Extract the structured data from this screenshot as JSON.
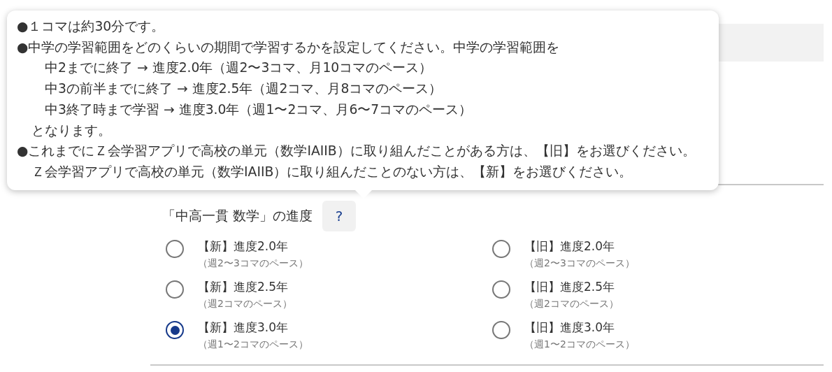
{
  "tooltip": {
    "lines": [
      {
        "kind": "bullet",
        "text": "●１コマは約30分です。"
      },
      {
        "kind": "bullet",
        "text": "●中学の学習範囲をどのくらいの期間で学習するかを設定してください。中学の学習範囲を"
      },
      {
        "kind": "indent",
        "text": "中2までに終了 → 進度2.0年（週2〜3コマ、月10コマのペース）"
      },
      {
        "kind": "indent",
        "text": "中3の前半までに終了 → 進度2.5年（週2コマ、月8コマのペース）"
      },
      {
        "kind": "indent",
        "text": "中3終了時まで学習 → 進度3.0年（週1〜2コマ、月6〜7コマのペース）"
      },
      {
        "kind": "plain",
        "text": "となります。"
      },
      {
        "kind": "bullet",
        "text": "●これまでにＺ会学習アプリで高校の単元（数学IAIIB）に取り組んだことがある方は、【旧】をお選びください。"
      },
      {
        "kind": "plain",
        "text": "Ｚ会学習アプリで高校の単元（数学IAIIB）に取り組んだことのない方は、【新】をお選びください。"
      }
    ]
  },
  "section": {
    "title": "「中高一貫 数学」の進度",
    "help_button": "?",
    "columns": [
      [
        {
          "label": "【新】進度2.0年",
          "note": "（週2〜3コマのペース）",
          "selected": false
        },
        {
          "label": "【新】進度2.5年",
          "note": "（週2コマのペース）",
          "selected": false
        },
        {
          "label": "【新】進度3.0年",
          "note": "（週1〜2コマのペース）",
          "selected": true
        }
      ],
      [
        {
          "label": "【旧】進度2.0年",
          "note": "（週2〜3コマのペース）",
          "selected": false
        },
        {
          "label": "【旧】進度2.5年",
          "note": "（週2コマのペース）",
          "selected": false
        },
        {
          "label": "【旧】進度3.0年",
          "note": "（週1〜2コマのペース）",
          "selected": false
        }
      ]
    ]
  }
}
